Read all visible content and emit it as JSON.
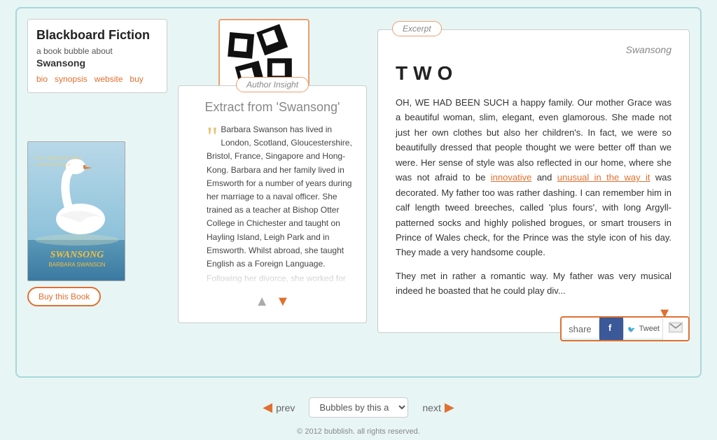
{
  "page": {
    "footer": "© 2012 bubblish. all rights reserved."
  },
  "info_card": {
    "title": "Blackboard Fiction",
    "subtitle": "a book bubble about",
    "book_name": "Swansong",
    "links": [
      "bio",
      "synopsis",
      "website",
      "buy"
    ]
  },
  "book_cover": {
    "title": "SWANSONG",
    "author": "BARBARA SWANSON"
  },
  "buy_button": {
    "label": "Buy this Book"
  },
  "author_insight": {
    "panel_label": "Author Insight",
    "title": "Extract from 'Swansong'",
    "text": "Barbara Swanson has lived in London, Scotland, Gloucestershire, Bristol, France, Singapore and Hong-Kong. Barbara and her family lived in Emsworth for a number of years during her marriage to a naval officer. She trained as a teacher at Bishop Otter College in Chichester and taught on Hayling Island, Leigh Park and in Emsworth. Whilst abroad, she taught English as a Foreign Language.\n\nFollowing her divorce, she worked for"
  },
  "excerpt": {
    "panel_label": "Excerpt",
    "book_title": "Swansong",
    "chapter": "TWO",
    "body": "OH, WE HAD BEEN SUCH a happy family. Our mother Grace was a beautiful woman, slim, elegant, even glamorous. She made not just her own clothes but also her children's. In fact, we were so beautifully dressed that people thought we were better off than we were. Her sense of style was also reflected in our home, where she was not afraid to be innovative and unusual in the way it was decorated. My father too was rather dashing. I can remember him in calf length tweed breeches, called 'plus fours', with long Argyll-patterned socks and highly polished brogues, or smart trousers in Prince of Wales check, for the Prince was the style icon of his day. They made a very handsome couple.",
    "body2": "They met in rather a romantic way. My father was very musical indeed he boasted that he could play div..."
  },
  "navigation": {
    "prev": "prev",
    "next": "next",
    "bubbles_select": "Bubbles by this a"
  },
  "share": {
    "label": "share",
    "facebook": "f",
    "tweet": "Tweet",
    "email": "✉"
  }
}
